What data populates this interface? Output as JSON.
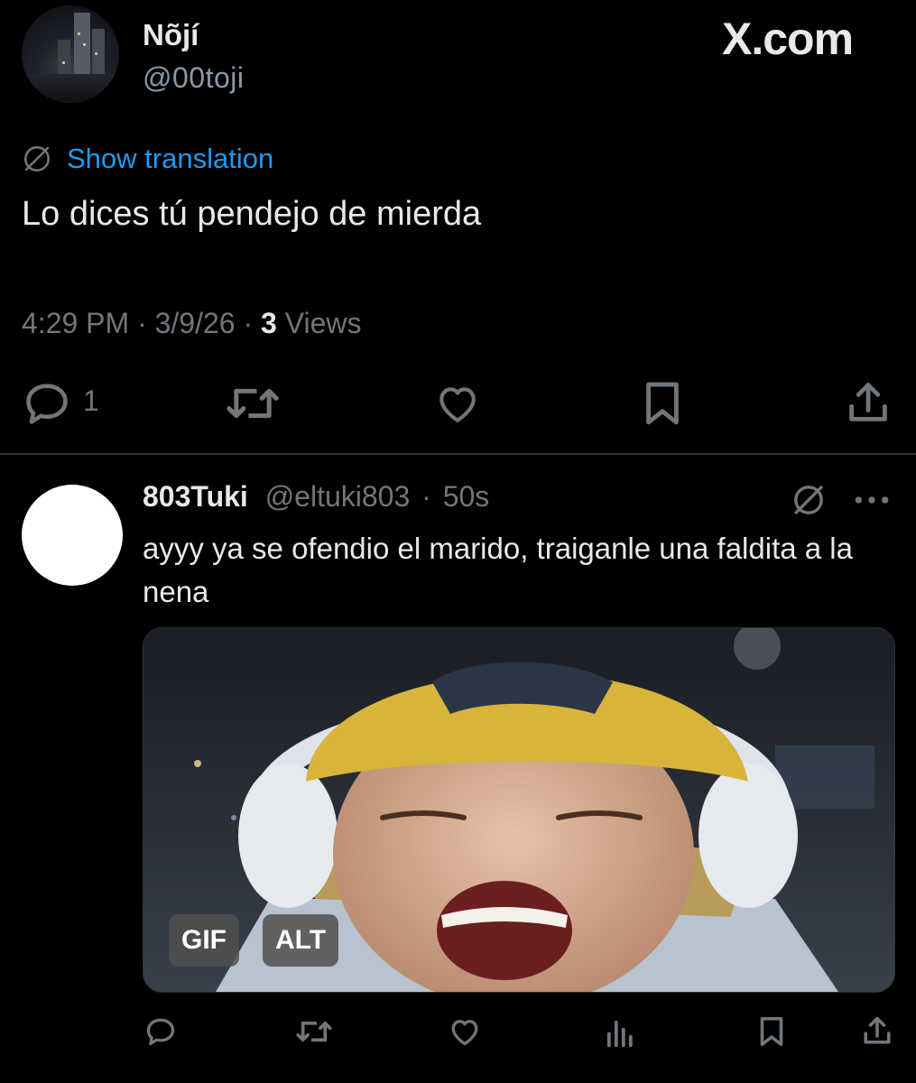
{
  "main_tweet": {
    "author_name": "Nõjí",
    "author_handle": "@00toji",
    "site_logo_text": "X.com",
    "translation_link": "Show translation",
    "text": "Lo dices tú pendejo de mierda",
    "time": "4:29 PM",
    "date": "3/9/26",
    "separator": "·",
    "views_count": "3",
    "views_label": "Views",
    "reply_count": "1"
  },
  "reply": {
    "author_name": "803Tuki",
    "author_handle": "@eltuki803",
    "separator": "·",
    "time_ago": "50s",
    "text": "ayyy ya se ofendio el marido, traiganle una faldita a la nena",
    "media": {
      "gif_badge": "GIF",
      "alt_badge": "ALT"
    }
  },
  "icons": {
    "translate": "translate-icon",
    "reply": "reply-icon",
    "repost": "repost-icon",
    "like": "like-icon",
    "bookmark": "bookmark-icon",
    "share": "share-icon",
    "more": "more-icon",
    "views": "views-icon"
  },
  "colors": {
    "background": "#000000",
    "text": "#e7e9ea",
    "muted": "#71767b",
    "link": "#1d9bf0",
    "divider": "#2f3336"
  }
}
